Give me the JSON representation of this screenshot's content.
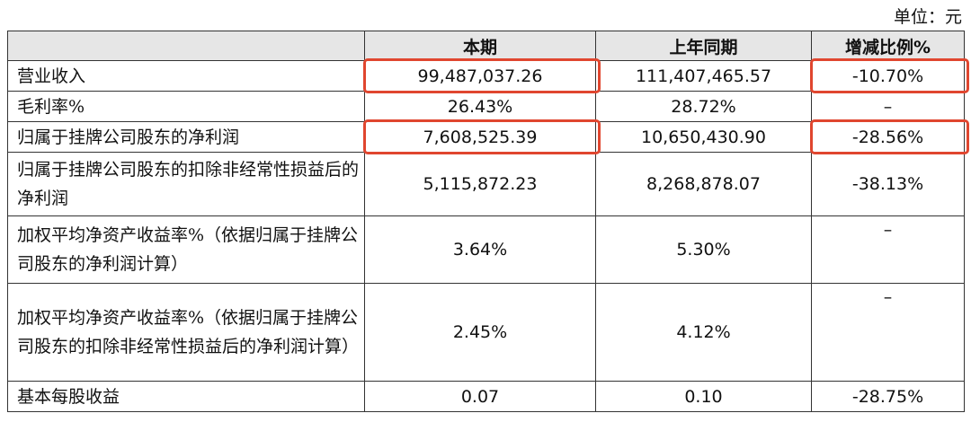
{
  "unit_label": "单位：元",
  "headers": [
    "",
    "本期",
    "上年同期",
    "增减比例%"
  ],
  "rows": [
    {
      "label": "营业收入",
      "current": "99,487,037.26",
      "prior": "111,407,465.57",
      "change": "-10.70%"
    },
    {
      "label": "毛利率%",
      "current": "26.43%",
      "prior": "28.72%",
      "change": "–"
    },
    {
      "label": "归属于挂牌公司股东的净利润",
      "current": "7,608,525.39",
      "prior": "10,650,430.90",
      "change": "-28.56%"
    },
    {
      "label": "归属于挂牌公司股东的扣除非经常性损益后的净利润",
      "current": "5,115,872.23",
      "prior": "8,268,878.07",
      "change": "-38.13%"
    },
    {
      "label": "加权平均净资产收益率%（依据归属于挂牌公司股东的净利润计算）",
      "current": "3.64%",
      "prior": "5.30%",
      "change": "–"
    },
    {
      "label": "加权平均净资产收益率%（依据归属于挂牌公司股东的扣除非经常性损益后的净利润计算）",
      "current": "2.45%",
      "prior": "4.12%",
      "change": "–"
    },
    {
      "label": "基本每股收益",
      "current": "0.07",
      "prior": "0.10",
      "change": "-28.75%"
    }
  ],
  "highlight_color": "#e0462f"
}
